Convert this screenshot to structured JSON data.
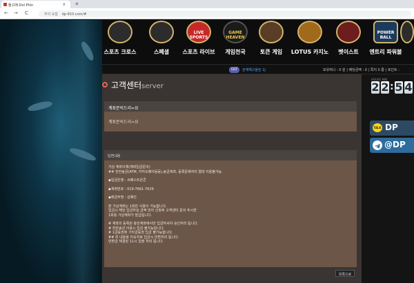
{
  "browser": {
    "tab_title": "돌고래-Dol Phin",
    "new_tab": "+",
    "tab_close": "x",
    "security_label": "주의 요함",
    "url": "dp-810.com/#",
    "back_icon": "←",
    "forward_icon": "→",
    "reload_icon": "C"
  },
  "nav": {
    "items": [
      {
        "label": "스포츠 크로스",
        "icon": "sports-balls-icon",
        "art": ""
      },
      {
        "label": "스페셜",
        "icon": "baseball-icon",
        "art": ""
      },
      {
        "label": "스포츠 라이브",
        "icon": "live-sports-icon",
        "art": "LIVE SPORTS"
      },
      {
        "label": "게임천국",
        "icon": "game-heaven-icon",
        "art": "GAME HEAVEN"
      },
      {
        "label": "토큰 게임",
        "icon": "token-game-icon",
        "art": ""
      },
      {
        "label": "LOTUS 카지노",
        "icon": "lotus-casino-icon",
        "art": ""
      },
      {
        "label": "벳이스트",
        "icon": "bet-east-icon",
        "art": ""
      },
      {
        "label": "엔트리 파워볼",
        "icon": "powerball-icon",
        "art": "POWER BALL"
      },
      {
        "label": "",
        "icon": "more-icon",
        "art": ""
      }
    ]
  },
  "infobar": {
    "level": "LV2",
    "user": "관계해고올린 1J",
    "stats": "보유머니 : 0 원 | 배당금액 : 0 | 쪽지 0 통 | 포인트 :"
  },
  "main": {
    "title": "고객센터",
    "title_sub": "server",
    "question_title": "계좌문의드리=요",
    "question_body": "계좌문의드리=요",
    "answer_heading": "답변내용",
    "answer_lines": [
      "가상 계좌이체(계좌입금문의)",
      "## 전한송금(ATM, 카카오페이등등),송금계좌, 등록문제처리 절대 이용불가능",
      "",
      "◆입금은행 : 씨페스트은콘",
      "",
      "◆계좌번호 : 019-7661-7629",
      "",
      "◆예금주명 : 김혜진",
      "",
      "본 가상계좌는 1회만 사용이 가능합니다.",
      "입금시 해당 입금하실 금액 먼저 신청후 고객센터 문의 주시면",
      "1회용 가상계좌가 발급됩니다.",
      "",
      "# 계좌의 등록된 충전계좌에서만 입금하셔야 승인처리 됩니다.",
      "# 전한송금 이용시 입금 불가능합니다.",
      "# 1금융권에 기타금융권 입금 불가능합니다.",
      "## 위 내용을 미숙지로 입금시 반환처리 됩니다.",
      "   반환금 체결된 11시 일괄 처리 됩니다."
    ],
    "list_button": "목록으로"
  },
  "sidebar": {
    "clock_heading": "HOURS   MIN",
    "digits": [
      "2",
      "2",
      "5",
      "4"
    ],
    "colon": ":",
    "talk_badge": "TALK",
    "talk_label": "DP",
    "telegram_label": "@DP"
  },
  "colors": {
    "accent_red": "#e06a5a",
    "user_blue": "#4aa6ff",
    "panel_brown": "#6b5648",
    "kakao_yellow": "#f7d51d"
  }
}
